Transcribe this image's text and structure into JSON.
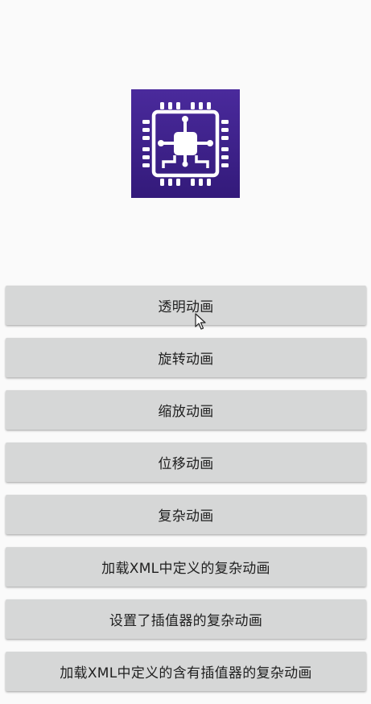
{
  "logo": {
    "icon": "cpu-chip-icon",
    "bg_color": "#3f1f8e",
    "fg_color": "#ffffff"
  },
  "buttons": [
    {
      "label": "透明动画"
    },
    {
      "label": "旋转动画"
    },
    {
      "label": "缩放动画"
    },
    {
      "label": "位移动画"
    },
    {
      "label": "复杂动画"
    },
    {
      "label": "加载XML中定义的复杂动画"
    },
    {
      "label": "设置了插值器的复杂动画"
    },
    {
      "label": "加载XML中定义的含有插值器的复杂动画"
    }
  ],
  "colors": {
    "background": "#fafafa",
    "button": "#d6d7d7",
    "button_text": "#1f1f1f"
  }
}
